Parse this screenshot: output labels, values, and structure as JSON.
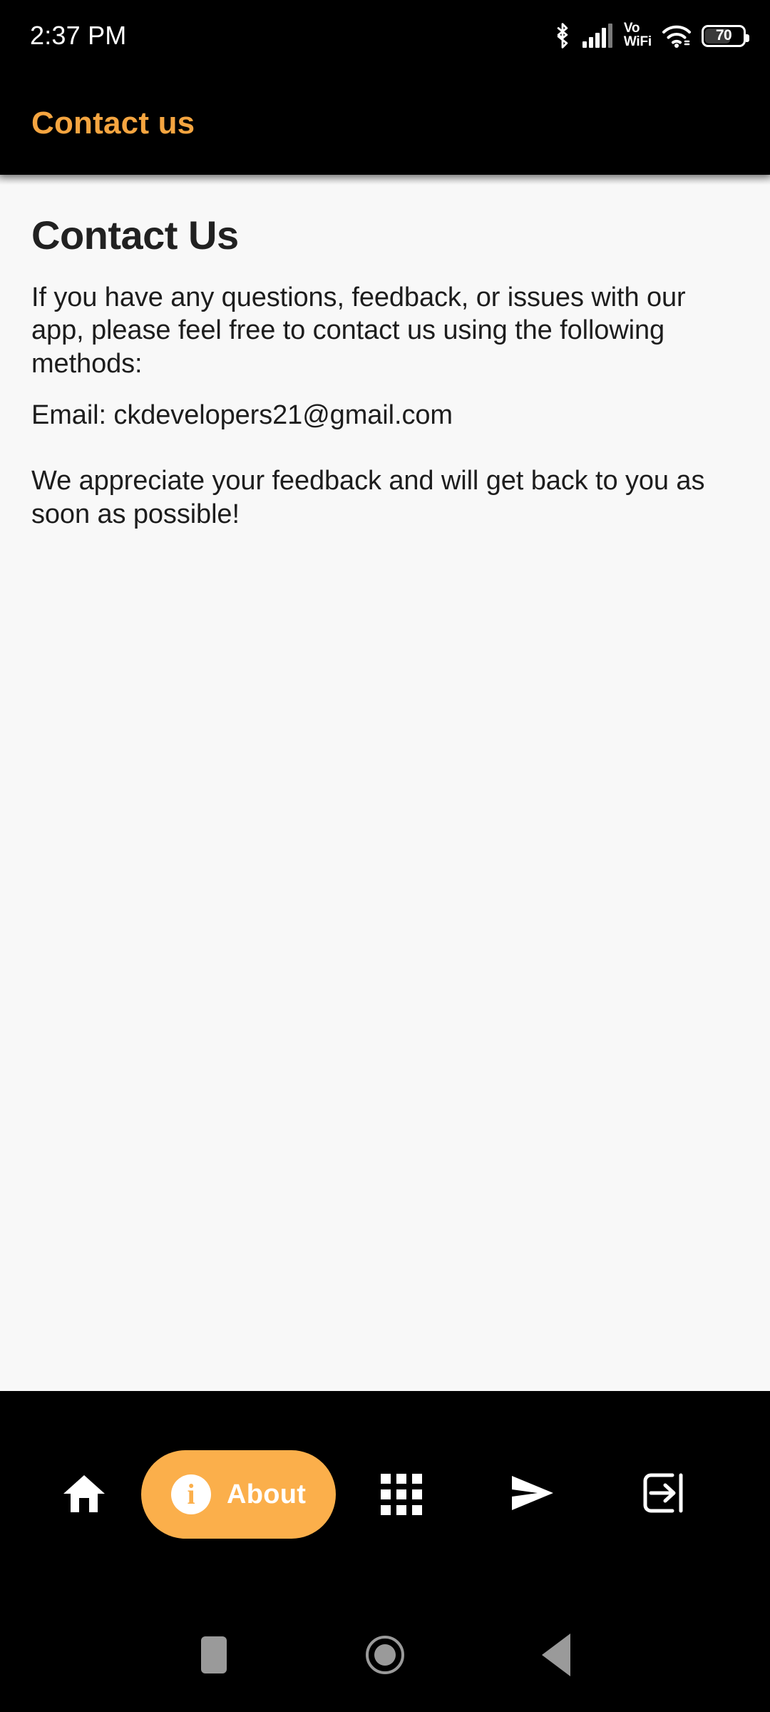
{
  "status_bar": {
    "time": "2:37 PM",
    "bluetooth_icon": "bluetooth-icon",
    "signal_icon": "cellular-signal-icon",
    "vowifi_line1": "Vo",
    "vowifi_line2": "WiFi",
    "wifi_icon": "wifi-icon",
    "battery_level": "70"
  },
  "app_bar": {
    "title": "Contact us",
    "title_color": "#f5a540"
  },
  "content": {
    "page_title": "Contact Us",
    "paragraph_1": "If you have any questions, feedback, or issues with our app, please feel free to contact us using the following methods:",
    "paragraph_2": "Email: ckdevelopers21@gmail.com",
    "paragraph_3": "We appreciate your feedback and will get back to you as soon as possible!",
    "background_color": "#f8f8f8"
  },
  "bottom_nav": {
    "accent_color": "#fbaf4b",
    "items": [
      {
        "name": "home",
        "icon": "home-icon",
        "label": "",
        "active": false
      },
      {
        "name": "about",
        "icon": "info-icon",
        "label": "About",
        "active": true
      },
      {
        "name": "apps",
        "icon": "grid-apps-icon",
        "label": "",
        "active": false
      },
      {
        "name": "send",
        "icon": "send-icon",
        "label": "",
        "active": false
      },
      {
        "name": "logout",
        "icon": "logout-icon",
        "label": "",
        "active": false
      }
    ]
  },
  "android_nav": {
    "recents": "square-recents-icon",
    "home": "circle-home-icon",
    "back": "triangle-back-icon",
    "color": "#9a9a9a"
  }
}
